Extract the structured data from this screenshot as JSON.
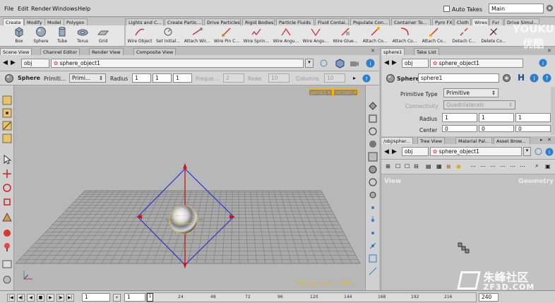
{
  "menu": [
    "File",
    "Edit",
    "Render",
    "Windows",
    "Help"
  ],
  "auto_takes": "Auto Takes",
  "desktop": "Main",
  "shelf_tabs_left": [
    "Create",
    "Modify",
    "Model",
    "Polygon"
  ],
  "shelf_tabs_right": [
    "Lights and C...",
    "Create Partic...",
    "Drive Particles",
    "Rigid Bodies",
    "Particle Fluids",
    "Fluid Contai...",
    "Populate Con...",
    "Container To...",
    "Pyro FX",
    "Cloth",
    "Wires",
    "Fur",
    "Drive Simul..."
  ],
  "shelf_tools_left": [
    "Box",
    "Sphere",
    "Tube",
    "Torus",
    "Grid"
  ],
  "shelf_tools_right": [
    "Wire Object",
    "Set Initial...",
    "Attach Wir...",
    "Wire Pin C...",
    "Wire Sprin...",
    "Wire Angu...",
    "Wire Angu...",
    "Wire Glue...",
    "Attach Co...",
    "Attach Co...",
    "Attach Co...",
    "Detach C...",
    "Delete Co..."
  ],
  "pane_tabs_left": [
    "Scene View",
    "Channel Editor",
    "Render View",
    "Composite View"
  ],
  "pane_tabs_right_top": [
    "sphere1",
    "Take List"
  ],
  "pane_tabs_right_bottom": [
    "/obj/spher...",
    "Tree View",
    "Material Pal...",
    "Asset Brow..."
  ],
  "path": {
    "obj": "obj",
    "node": "sphere_object1"
  },
  "operator": {
    "name": "Sphere",
    "primitive_label": "Primiti...",
    "primitive_value": "Primi...",
    "radius_label": "Radius",
    "radius": [
      "1",
      "1",
      "1"
    ],
    "freq_label": "Freque...",
    "freq": "2",
    "rows_label": "Rows",
    "rows": "10",
    "cols_label": "Columns",
    "cols": "10"
  },
  "viewport": {
    "camera": "persp1",
    "display": "no cam",
    "watermark": "Non-Commercial Edition"
  },
  "params": {
    "type": "Sphere",
    "name": "sphere1",
    "primitive_type_label": "Primitive Type",
    "primitive_type": "Primitive",
    "connectivity_label": "Connectivity",
    "connectivity": "Quadrilaterals",
    "radius_label": "Radius",
    "radius": [
      "1",
      "1",
      "1"
    ],
    "center_label": "Center",
    "center": [
      "0",
      "0",
      "0"
    ]
  },
  "network": {
    "path_obj": "obj",
    "path_node": "sphere_object1",
    "view_label": "View",
    "context_label": "Geometry"
  },
  "timeline": {
    "frame": "1",
    "start": "1",
    "end": "240",
    "ticks": [
      "24",
      "48",
      "72",
      "96",
      "120",
      "144",
      "168",
      "192",
      "216"
    ]
  },
  "watermarks": {
    "top_right_1": "YOUKU",
    "top_right_2": "优酷",
    "bottom_right_1": "朱峰社区",
    "bottom_right_2": "ZF3D.COM"
  },
  "colors": {
    "bg": "#b7b7b7",
    "accent": "#ffb400",
    "handle_blue": "#2a32d8",
    "handle_red": "#c51818"
  }
}
